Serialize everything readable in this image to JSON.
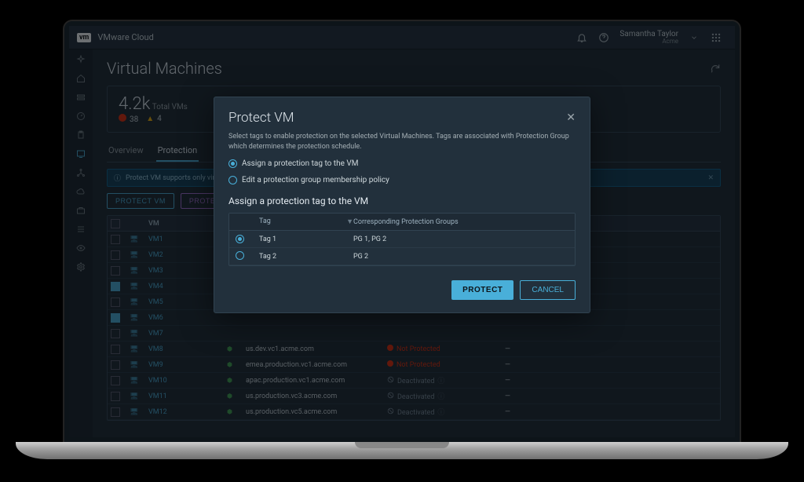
{
  "topbar": {
    "logo": "vm",
    "app_name": "VMware Cloud",
    "user_name": "Samantha Taylor",
    "tenant": "Acme"
  },
  "page": {
    "title": "Virtual Machines"
  },
  "summary": {
    "count_label": "4.2k",
    "count_sub": "Total VMs",
    "errors": "38",
    "warnings": "4"
  },
  "tabs": {
    "overview": "Overview",
    "protection": "Protection"
  },
  "banner": {
    "text": "Protect VM supports only virtual machines …"
  },
  "actions": {
    "protect": "PROTECT VM",
    "protected": "PROTECTED"
  },
  "columns": {
    "vm": "VM",
    "vcenter": "",
    "status": "",
    "groups": ""
  },
  "vms": [
    {
      "name": "VM1",
      "checked": false,
      "vcenter": "",
      "status": "",
      "pg": ""
    },
    {
      "name": "VM2",
      "checked": false,
      "vcenter": "",
      "status": "",
      "pg": ""
    },
    {
      "name": "VM3",
      "checked": false,
      "vcenter": "",
      "status": "",
      "pg": ""
    },
    {
      "name": "VM4",
      "checked": true,
      "vcenter": "",
      "status": "",
      "pg": ""
    },
    {
      "name": "VM5",
      "checked": false,
      "vcenter": "",
      "status": "",
      "pg": ""
    },
    {
      "name": "VM6",
      "checked": true,
      "vcenter": "",
      "status": "",
      "pg": ""
    },
    {
      "name": "VM7",
      "checked": false,
      "vcenter": "",
      "status": "",
      "pg": ""
    },
    {
      "name": "VM8",
      "checked": false,
      "vcenter": "us.dev.vc1.acme.com",
      "status": "Not Protected",
      "status_kind": "not",
      "pg": "—"
    },
    {
      "name": "VM9",
      "checked": false,
      "vcenter": "emea.production.vc1.acme.com",
      "status": "Not Protected",
      "status_kind": "not",
      "pg": "—"
    },
    {
      "name": "VM10",
      "checked": false,
      "vcenter": "apac.production.vc1.acme.com",
      "status": "Deactivated",
      "status_kind": "deact",
      "pg": "—"
    },
    {
      "name": "VM11",
      "checked": false,
      "vcenter": "us.production.vc3.acme.com",
      "status": "Deactivated",
      "status_kind": "deact",
      "pg": "—"
    },
    {
      "name": "VM12",
      "checked": false,
      "vcenter": "us.production.vc5.acme.com",
      "status": "Deactivated",
      "status_kind": "deact",
      "pg": "—"
    }
  ],
  "modal": {
    "title": "Protect VM",
    "desc": "Select tags to enable protection on the selected Virtual Machines. Tags are associated with Protection Group which determines the protection schedule.",
    "opt_assign": "Assign a protection tag to the VM",
    "opt_edit": "Edit a protection group membership policy",
    "subhead": "Assign a protection tag to the VM",
    "col_tag": "Tag",
    "col_pg": "Corresponding Protection Groups",
    "tags": [
      {
        "label": "Tag 1",
        "pg": "PG 1, PG 2",
        "selected": true
      },
      {
        "label": "Tag 2",
        "pg": "PG 2",
        "selected": false
      }
    ],
    "protect_btn": "PROTECT",
    "cancel_btn": "CANCEL"
  }
}
